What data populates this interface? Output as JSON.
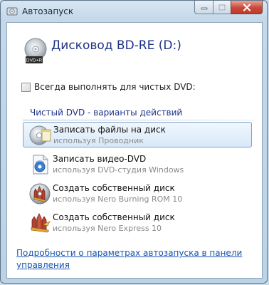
{
  "window": {
    "title": "Автозапуск"
  },
  "device": {
    "title": "Дисковод BD-RE (D:)",
    "disc_label": "DVD+R"
  },
  "always_checkbox": {
    "label": "Всегда выполнять для чистых DVD:",
    "checked": false
  },
  "section": {
    "header": "Чистый DVD - варианты действий"
  },
  "actions": [
    {
      "title": "Записать файлы на диск",
      "subtitle": "используя Проводник",
      "icon": "disc-burn-icon",
      "selected": true
    },
    {
      "title": "Записать видео-DVD",
      "subtitle": "используя DVD-студия Windows",
      "icon": "dvd-studio-icon",
      "selected": false
    },
    {
      "title": "Создать собственный диск",
      "subtitle": "используя Nero Burning ROM 10",
      "icon": "nero-burning-rom-icon",
      "selected": false
    },
    {
      "title": "Создать собственный диск",
      "subtitle": "используя Nero Express 10",
      "icon": "nero-express-icon",
      "selected": false
    }
  ],
  "footer": {
    "link": "Подробности о параметрах автозапуска в панели управления"
  },
  "colors": {
    "accent": "#1e3287",
    "link": "#1855b0",
    "selection": "#d8e8f8"
  }
}
